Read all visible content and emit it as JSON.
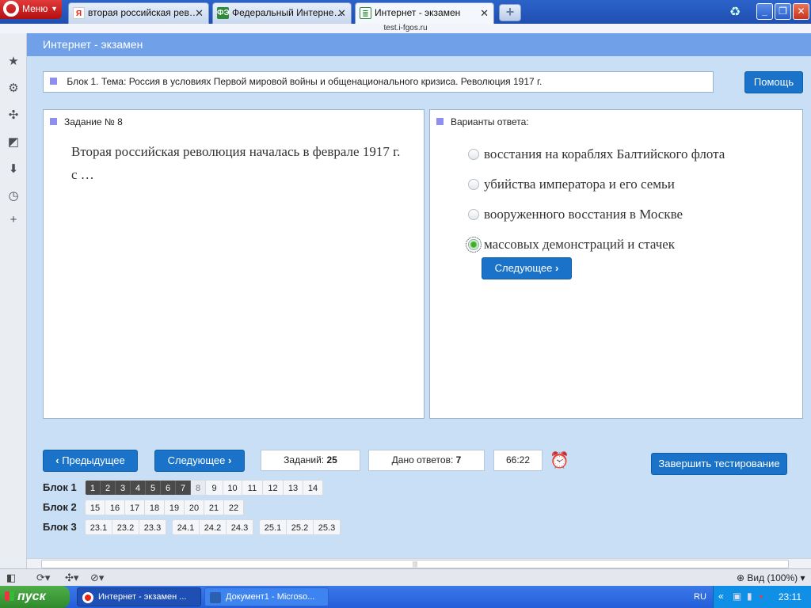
{
  "browser": {
    "menu_label": "Меню",
    "tabs": [
      {
        "label": "вторая российская рев…",
        "icon": "yandex-icon",
        "active": false
      },
      {
        "label": "Федеральный Интерне…",
        "icon": "fi-icon",
        "active": false
      },
      {
        "label": "Интернет - экзамен",
        "icon": "page-icon",
        "active": true
      }
    ],
    "url": "test.i-fgos.ru",
    "status": {
      "zoom_label": "Вид (100%)"
    }
  },
  "app": {
    "header_title": "Интернет - экзамен",
    "topic": "Блок 1. Тема: Россия в условиях Первой мировой войны и общенационального кризиса. Революция 1917 г.",
    "help_label": "Помощь",
    "question": {
      "title": "Задание № 8",
      "text": "Вторая российская революция началась в феврале 1917 г. с …"
    },
    "answers": {
      "title": "Варианты ответа:",
      "options": [
        {
          "label": "восстания на кораблях Балтийского флота",
          "selected": false
        },
        {
          "label": "убийства императора и его семьи",
          "selected": false
        },
        {
          "label": "вооруженного восстания в Москве",
          "selected": false
        },
        {
          "label": "массовых демонстраций и стачек",
          "selected": true
        }
      ],
      "next_label": "Следующее"
    },
    "nav": {
      "prev_label": "Предыдущее",
      "next_label": "Следующее",
      "tasks_label": "Заданий:",
      "tasks_count": "25",
      "answered_label": "Дано ответов:",
      "answered_count": "7",
      "timer": "66:22",
      "finish_label": "Завершить тестирование"
    },
    "blocks": [
      {
        "label": "Блок 1",
        "groups": [
          [
            "1",
            "2",
            "3",
            "4",
            "5",
            "6",
            "7",
            "8",
            "9",
            "10",
            "11",
            "12",
            "13",
            "14"
          ]
        ]
      },
      {
        "label": "Блок 2",
        "groups": [
          [
            "15",
            "16",
            "17",
            "18",
            "19",
            "20",
            "21",
            "22"
          ]
        ]
      },
      {
        "label": "Блок 3",
        "groups": [
          [
            "23.1",
            "23.2",
            "23.3"
          ],
          [
            "24.1",
            "24.2",
            "24.3"
          ],
          [
            "25.1",
            "25.2",
            "25.3"
          ]
        ]
      }
    ]
  },
  "taskbar": {
    "start_label": "пуск",
    "tasks": [
      {
        "label": "Интернет - экзамен ...",
        "active": true
      },
      {
        "label": "Документ1 - Microso...",
        "active": false
      }
    ],
    "lang": "RU",
    "clock": "23:11"
  }
}
